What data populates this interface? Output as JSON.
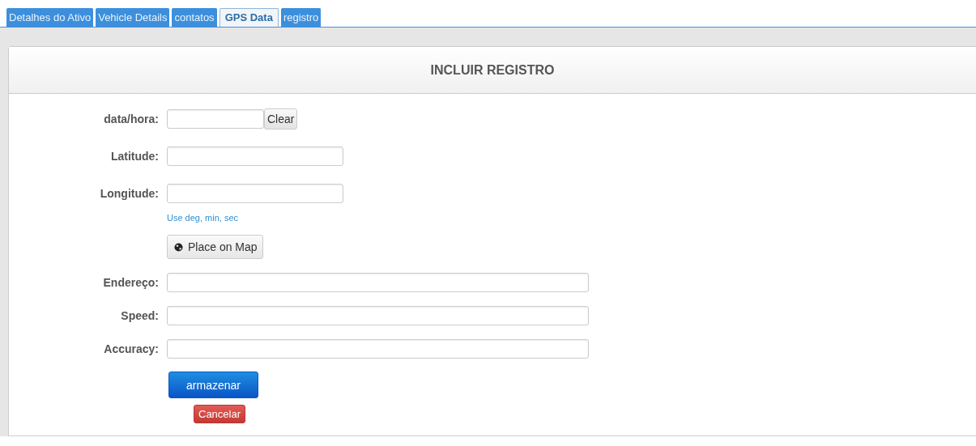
{
  "tabs": [
    {
      "label": "Detalhes do Ativo",
      "selected": false
    },
    {
      "label": "Vehicle Details",
      "selected": false
    },
    {
      "label": "contatos",
      "selected": false
    },
    {
      "label": "GPS Data",
      "selected": true
    },
    {
      "label": "registro",
      "selected": false
    }
  ],
  "panel": {
    "title": "INCLUIR REGISTRO"
  },
  "rows": [
    {
      "kind": "date",
      "label": "data/hora:",
      "button": "Clear"
    },
    {
      "kind": "short",
      "label": "Latitude:"
    },
    {
      "kind": "short",
      "label": "Longitude:"
    },
    {
      "kind": "hint",
      "text": "Use deg, min, sec"
    },
    {
      "kind": "map",
      "text": "Place on Map"
    },
    {
      "kind": "wide",
      "label": "Endereço:"
    },
    {
      "kind": "wide",
      "label": "Speed:"
    },
    {
      "kind": "wide",
      "label": "Accuracy:"
    }
  ],
  "actions": {
    "submit": "armazenar",
    "cancel": "Cancelar"
  }
}
